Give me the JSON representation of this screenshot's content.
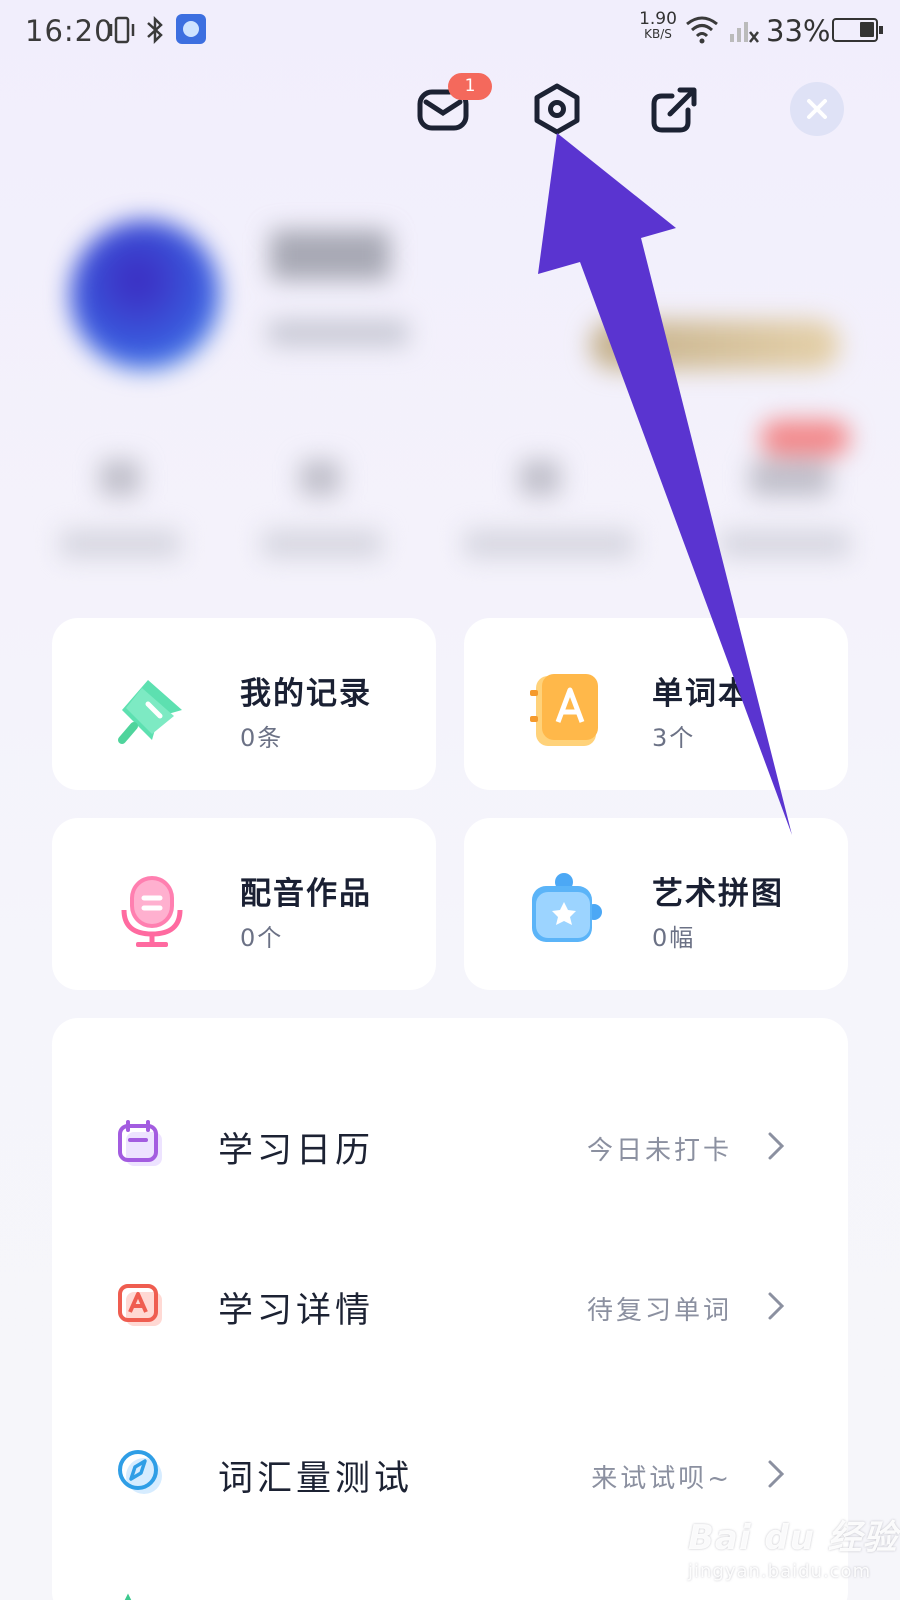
{
  "status_bar": {
    "time": "16:20",
    "net_speed_value": "1.90",
    "net_speed_unit": "KB/S",
    "battery": "33%"
  },
  "header": {
    "mail_badge": "1"
  },
  "cards": [
    {
      "title": "我的记录",
      "count": "0条",
      "icon": "pin-icon"
    },
    {
      "title": "单词本",
      "count": "3个",
      "icon": "wordbook-icon"
    },
    {
      "title": "配音作品",
      "count": "0个",
      "icon": "microphone-icon"
    },
    {
      "title": "艺术拼图",
      "count": "0幅",
      "icon": "puzzle-icon"
    }
  ],
  "list": [
    {
      "label": "学习日历",
      "status": "今日未打卡",
      "icon": "calendar-icon"
    },
    {
      "label": "学习详情",
      "status": "待复习单词",
      "icon": "study-detail-icon"
    },
    {
      "label": "词汇量测试",
      "status": "来试试呗~",
      "icon": "compass-icon"
    }
  ],
  "colors": {
    "accent_arrow": "#5a34d0",
    "badge": "#f4695c",
    "title_text": "#1a2033"
  },
  "watermark": {
    "main": "Bai du 经验",
    "sub": "jingyan.baidu.com"
  }
}
